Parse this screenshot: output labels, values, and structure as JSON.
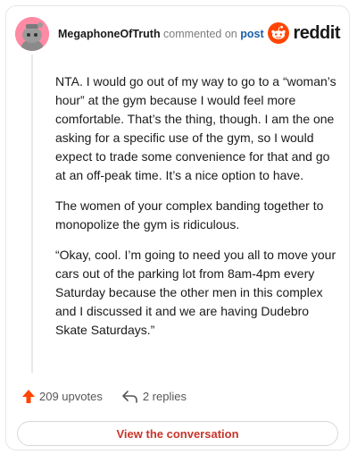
{
  "comment": {
    "username": "MegaphoneOfTruth",
    "action_text": " commented on ",
    "target_link": "post",
    "paragraphs": [
      "NTA. I would go out of my way to go to a “woman’s hour” at the gym because I would feel more comfortable. That’s the thing, though. I am the one asking for a specific use of the gym, so I would expect to trade some convenience for that and go at an off-peak time. It’s a nice option to have.",
      "The women of your complex banding together to monopolize the gym is ridiculous.",
      "“Okay, cool. I’m going to need you all to move your cars out of the parking lot from 8am-4pm every Saturday because the other men in this complex and I discussed it and we are having Dudebro Skate Saturdays.”"
    ],
    "upvotes": "209 upvotes",
    "replies": "2 replies"
  },
  "brand": {
    "wordmark": "reddit",
    "accent": "#ff4500"
  },
  "cta": {
    "label": "View the conversation"
  },
  "icons": {
    "upvote": "upvote-arrow-icon",
    "reply": "reply-arrow-icon",
    "brand": "reddit-snoo-icon",
    "avatar": "snoo-avatar"
  }
}
